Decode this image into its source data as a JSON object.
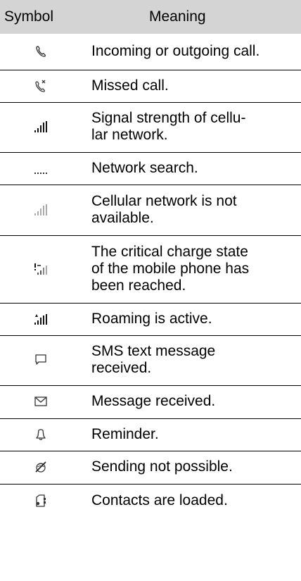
{
  "table": {
    "header": {
      "symbol": "Symbol",
      "meaning": "Meaning"
    },
    "rows": [
      {
        "icon": "call-icon",
        "lines": [
          "Incoming or outgoing call."
        ]
      },
      {
        "icon": "missed-call-icon",
        "lines": [
          "Missed call."
        ]
      },
      {
        "icon": "signal-strength-icon",
        "lines": [
          "Signal strength of cellu-",
          "lar network."
        ]
      },
      {
        "icon": "network-search-icon",
        "lines": [
          "Network search."
        ]
      },
      {
        "icon": "no-network-icon",
        "lines": [
          "Cellular network is not",
          "available."
        ]
      },
      {
        "icon": "critical-charge-icon",
        "lines": [
          "The critical charge state",
          "of the mobile phone has",
          "been reached."
        ]
      },
      {
        "icon": "roaming-icon",
        "lines": [
          "Roaming is active."
        ]
      },
      {
        "icon": "sms-icon",
        "lines": [
          "SMS text message",
          "received."
        ]
      },
      {
        "icon": "envelope-icon",
        "lines": [
          "Message received."
        ]
      },
      {
        "icon": "bell-icon",
        "lines": [
          "Reminder."
        ]
      },
      {
        "icon": "sending-not-possible-icon",
        "lines": [
          "Sending not possible."
        ]
      },
      {
        "icon": "contacts-loaded-icon",
        "lines": [
          "Contacts are loaded."
        ]
      }
    ]
  }
}
